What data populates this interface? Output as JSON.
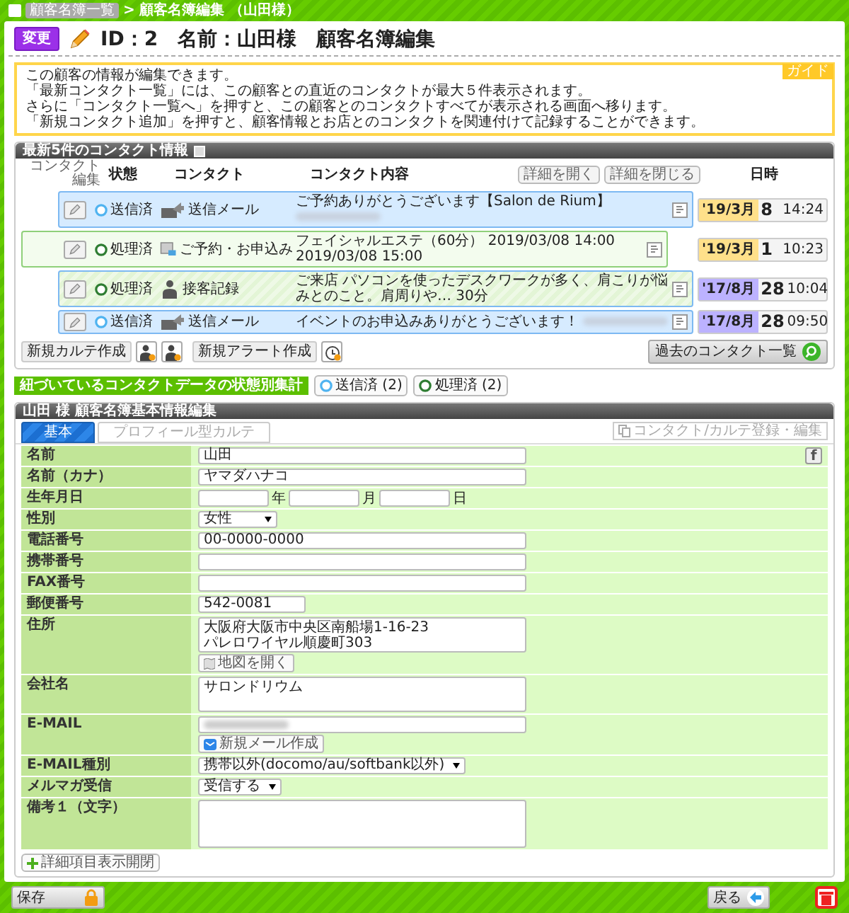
{
  "breadcrumb": {
    "items": [
      {
        "label": "顧客名簿一覧",
        "kind": "link"
      },
      {
        "label": "顧客名簿編集 （山田様）",
        "kind": "current"
      }
    ],
    "separator": ">"
  },
  "header": {
    "badge": "変更",
    "title": "ID：2　名前：山田様　顧客名簿編集"
  },
  "guide": {
    "tag": "ガイド",
    "lines": [
      "この顧客の情報が編集できます。",
      "「最新コンタクト一覧」には、この顧客との直近のコンタクトが最大５件表示されます。",
      "さらに「コンタクト一覧へ」を押すと、この顧客とのコンタクトすべてが表示される画面へ移ります。",
      "「新規コンタクト追加」を押すと、顧客情報とお店とのコンタクトを関連付けて記録することができます。"
    ]
  },
  "contacts": {
    "title": "最新5件のコンタクト情報",
    "columns": [
      "コンタクト編集",
      "状態",
      "コンタクト",
      "コンタクト内容",
      "日時"
    ],
    "expand_button": "詳細を開く",
    "collapse_button": "詳細を閉じる",
    "rows": [
      {
        "kind": "mail",
        "status": {
          "label": "送信済",
          "color": "#4fb3f0"
        },
        "type": "送信メール",
        "content": "ご予約ありがとうございます【Salon de Rium】",
        "redacted": true,
        "date": {
          "month": "'19/3月",
          "day": "8",
          "time": "14:24",
          "color": "#ffe08a"
        }
      },
      {
        "kind": "reservation",
        "status": {
          "label": "処理済",
          "color": "#2e7d32"
        },
        "type": "ご予約・お申込み",
        "content": "フェイシャルエステ（60分） 2019/03/08 14:00 2019/03/08 15:00",
        "redacted": false,
        "date": {
          "month": "'19/3月",
          "day": "1",
          "time": "10:23",
          "color": "#ffe08a"
        }
      },
      {
        "kind": "record",
        "status": {
          "label": "処理済",
          "color": "#2e7d32"
        },
        "type": "接客記録",
        "content": "ご来店 パソコンを使ったデスクワークが多く、肩こりが悩みとのこと。肩周りや… 30分",
        "redacted": false,
        "date": {
          "month": "'17/8月",
          "day": "28",
          "time": "10:04",
          "color": "#bcb2ff"
        }
      },
      {
        "kind": "mail",
        "status": {
          "label": "送信済",
          "color": "#4fb3f0"
        },
        "type": "送信メール",
        "content": "イベントのお申込みありがとうございます！",
        "redacted": true,
        "date": {
          "month": "'17/8月",
          "day": "28",
          "time": "09:50",
          "color": "#bcb2ff"
        }
      }
    ],
    "new_chart": "新規カルテ作成",
    "new_alert": "新規アラート作成",
    "history_button": "過去のコンタクト一覧"
  },
  "summary": {
    "label": "紐づいているコンタクトデータの状態別集計",
    "items": [
      {
        "label": "送信済 (2)",
        "color": "#4fb3f0"
      },
      {
        "label": "処理済 (2)",
        "color": "#2e7d32"
      }
    ]
  },
  "form": {
    "title": "山田 様 顧客名簿基本情報編集",
    "tabs": [
      {
        "label": "基本",
        "selected": true
      },
      {
        "label": "プロフィール型カルテ",
        "selected": false
      }
    ],
    "register_button": "コンタクト/カルテ登録・編集",
    "fields": [
      {
        "label": "名前",
        "kind": "text",
        "value": "山田",
        "side_icon": "f"
      },
      {
        "label": "名前（カナ）",
        "kind": "text",
        "value": "ヤマダハナコ"
      },
      {
        "label": "生年月日",
        "kind": "date",
        "units": [
          "年",
          "月",
          "日"
        ]
      },
      {
        "label": "性別",
        "kind": "select",
        "value": "女性"
      },
      {
        "label": "電話番号",
        "kind": "text",
        "value": "00-0000-0000"
      },
      {
        "label": "携帯番号",
        "kind": "text"
      },
      {
        "label": "FAX番号",
        "kind": "text"
      },
      {
        "label": "郵便番号",
        "kind": "short",
        "value": "542-0081"
      },
      {
        "label": "住所",
        "kind": "textarea",
        "value": "大阪府大阪市中央区南船場1-16-23\nパレロワイヤル順慶町303",
        "button": {
          "label": "地図を開く",
          "kind": "map"
        }
      },
      {
        "label": "会社名",
        "kind": "textarea",
        "value": "サロンドリウム"
      },
      {
        "label": "E-MAIL",
        "kind": "text",
        "redacted": true,
        "button": {
          "label": "新規メール作成",
          "kind": "mail"
        }
      },
      {
        "label": "E-MAIL種別",
        "kind": "select",
        "value": "携帯以外(docomo/au/softbank以外)"
      },
      {
        "label": "メルマガ受信",
        "kind": "select",
        "value": "受信する"
      },
      {
        "label": "備考１（文字）",
        "kind": "memo"
      }
    ],
    "details_button": "詳細項目表示開閉"
  },
  "footer": {
    "save": "保存",
    "back": "戻る"
  }
}
